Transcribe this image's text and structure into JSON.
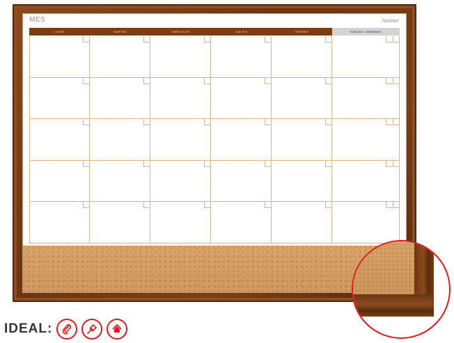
{
  "board": {
    "month_label": "MES",
    "brand": "Azamar",
    "days": [
      "LUNES",
      "MARTES",
      "MIÉRCOLES",
      "JUEVES",
      "VIERNES",
      "SÁBADO / DOMINGO"
    ]
  },
  "footer": {
    "ideal_label": "IDEAL:",
    "icons": [
      "paperclip-icon",
      "pin-icon",
      "home-icon"
    ]
  },
  "colors": {
    "frame_wood": "#6b3512",
    "header_brown": "#7a3e12",
    "accent_red": "#e0191e",
    "cork": "#d9a46a"
  }
}
